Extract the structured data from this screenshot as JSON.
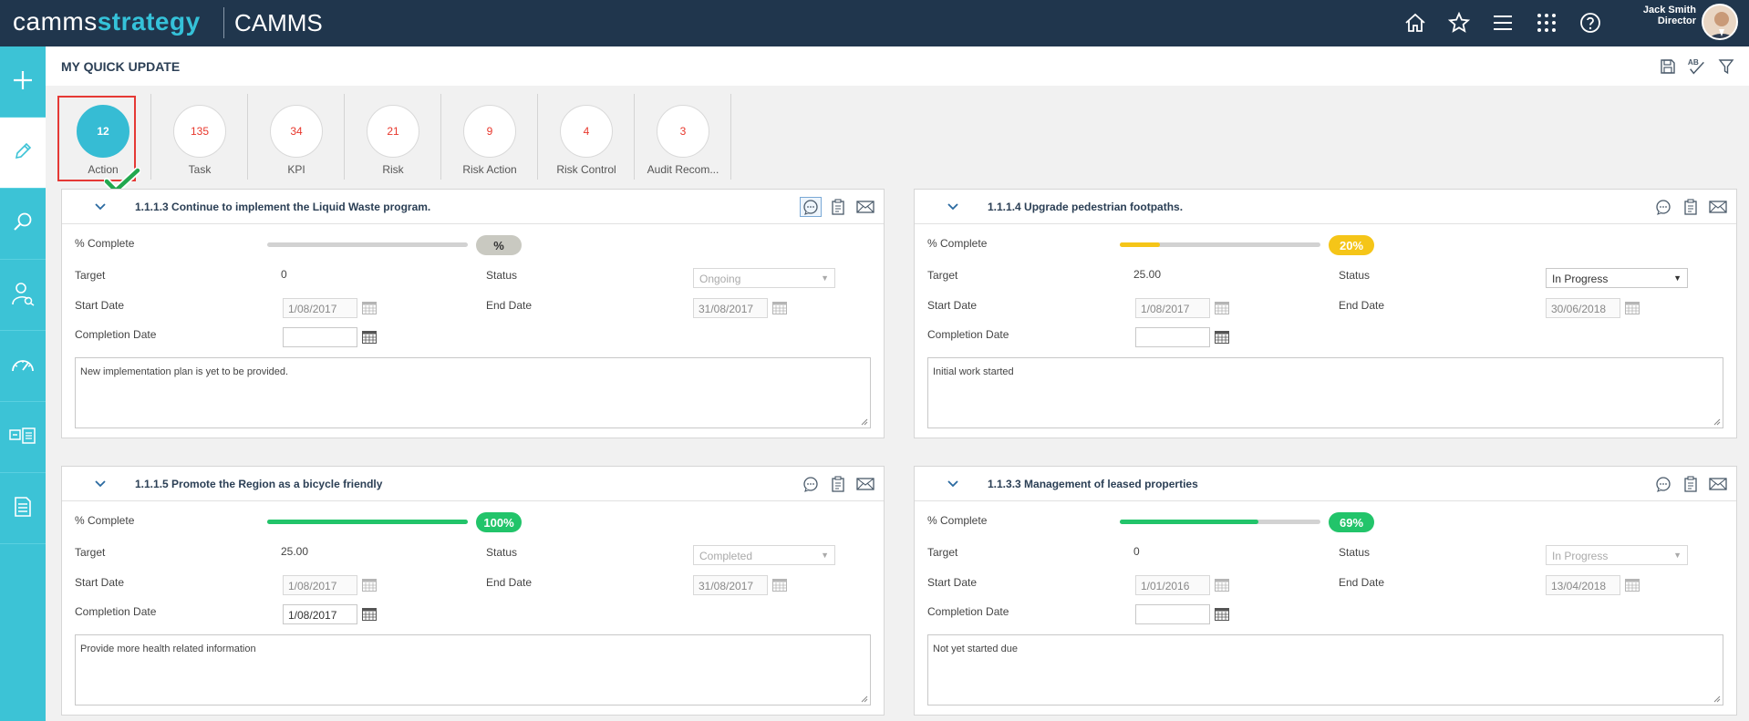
{
  "brand": {
    "part1": "camms",
    "part2": "strategy",
    "app_name": "CAMMS"
  },
  "user": {
    "name": "Jack Smith",
    "role": "Director"
  },
  "top_icons": [
    "home-icon",
    "star-icon",
    "menu-icon",
    "apps-grid-icon",
    "help-icon"
  ],
  "sidebar_icons": [
    "plus-icon",
    "pencil-icon",
    "search-icon",
    "person-search-icon",
    "gauge-icon",
    "list-card-icon",
    "document-icon"
  ],
  "page": {
    "title": "MY QUICK UPDATE"
  },
  "header_tools": [
    "save-icon",
    "spellcheck-icon",
    "filter-icon"
  ],
  "categories": [
    {
      "count": "12",
      "label": "Action",
      "active": true
    },
    {
      "count": "135",
      "label": "Task"
    },
    {
      "count": "34",
      "label": "KPI"
    },
    {
      "count": "21",
      "label": "Risk"
    },
    {
      "count": "9",
      "label": "Risk Action"
    },
    {
      "count": "4",
      "label": "Risk Control"
    },
    {
      "count": "3",
      "label": "Audit Recom..."
    }
  ],
  "labels": {
    "complete": "% Complete",
    "target": "Target",
    "status": "Status",
    "start_date": "Start Date",
    "end_date": "End Date",
    "completion_date": "Completion Date"
  },
  "cards": [
    {
      "title": "1.1.1.3 Continue to implement the Liquid Waste program.",
      "percent_label": "%",
      "percent": 0,
      "badge_color": "#c9c9c1",
      "badge_text_color": "#333333",
      "fill_color": "#c9c9c1",
      "target": "0",
      "status": "Ongoing",
      "status_disabled": true,
      "start_date": "1/08/2017",
      "end_date": "31/08/2017",
      "completion_date": "",
      "notes": "New implementation plan is yet to be provided."
    },
    {
      "title": "1.1.1.4 Upgrade pedestrian footpaths.",
      "percent_label": "20%",
      "percent": 20,
      "badge_color": "#f5c518",
      "badge_text_color": "#ffffff",
      "fill_color": "#f5c518",
      "target": "25.00",
      "status": "In Progress",
      "status_disabled": false,
      "start_date": "1/08/2017",
      "end_date": "30/06/2018",
      "completion_date": "",
      "notes": "Initial work started"
    },
    {
      "title": "1.1.1.5 Promote the Region as a bicycle friendly",
      "percent_label": "100%",
      "percent": 100,
      "badge_color": "#22c46a",
      "badge_text_color": "#ffffff",
      "fill_color": "#22c46a",
      "target": "25.00",
      "status": "Completed",
      "status_disabled": true,
      "start_date": "1/08/2017",
      "end_date": "31/08/2017",
      "completion_date": "1/08/2017",
      "notes": "Provide more health related information"
    },
    {
      "title": "1.1.3.3 Management of leased properties",
      "percent_label": "69%",
      "percent": 69,
      "badge_color": "#22c46a",
      "badge_text_color": "#ffffff",
      "fill_color": "#22c46a",
      "target": "0",
      "status": "In Progress",
      "status_disabled": true,
      "start_date": "1/01/2016",
      "end_date": "13/04/2018",
      "completion_date": "",
      "notes": "Not yet started due"
    }
  ]
}
